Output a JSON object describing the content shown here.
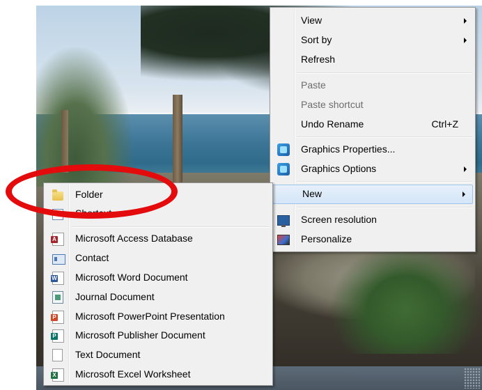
{
  "context_menu": {
    "items": [
      {
        "label": "View",
        "has_submenu": true
      },
      {
        "label": "Sort by",
        "has_submenu": true
      },
      {
        "label": "Refresh"
      },
      {
        "label": "Paste",
        "disabled": true
      },
      {
        "label": "Paste shortcut",
        "disabled": true
      },
      {
        "label": "Undo Rename",
        "shortcut": "Ctrl+Z"
      },
      {
        "label": "Graphics Properties...",
        "icon": "graphics-icon"
      },
      {
        "label": "Graphics Options",
        "icon": "graphics-icon",
        "has_submenu": true
      },
      {
        "label": "New",
        "has_submenu": true,
        "highlighted": true
      },
      {
        "label": "Screen resolution",
        "icon": "screen-resolution-icon"
      },
      {
        "label": "Personalize",
        "icon": "personalize-icon"
      }
    ]
  },
  "new_submenu": {
    "items": [
      {
        "label": "Folder",
        "icon": "folder-icon"
      },
      {
        "label": "Shortcut",
        "icon": "shortcut-icon"
      },
      {
        "label": "Microsoft Access Database",
        "icon": "access-icon",
        "badge": "A",
        "color": "#a4262c"
      },
      {
        "label": "Contact",
        "icon": "contact-icon"
      },
      {
        "label": "Microsoft Word Document",
        "icon": "word-icon",
        "badge": "W",
        "color": "#2b579a"
      },
      {
        "label": "Journal Document",
        "icon": "journal-icon"
      },
      {
        "label": "Microsoft PowerPoint Presentation",
        "icon": "powerpoint-icon",
        "badge": "P",
        "color": "#d24726"
      },
      {
        "label": "Microsoft Publisher Document",
        "icon": "publisher-icon",
        "badge": "P",
        "color": "#077568"
      },
      {
        "label": "Text Document",
        "icon": "text-document-icon"
      },
      {
        "label": "Microsoft Excel Worksheet",
        "icon": "excel-icon",
        "badge": "X",
        "color": "#217346"
      }
    ]
  },
  "annotation": {
    "color": "#e30b0b"
  }
}
